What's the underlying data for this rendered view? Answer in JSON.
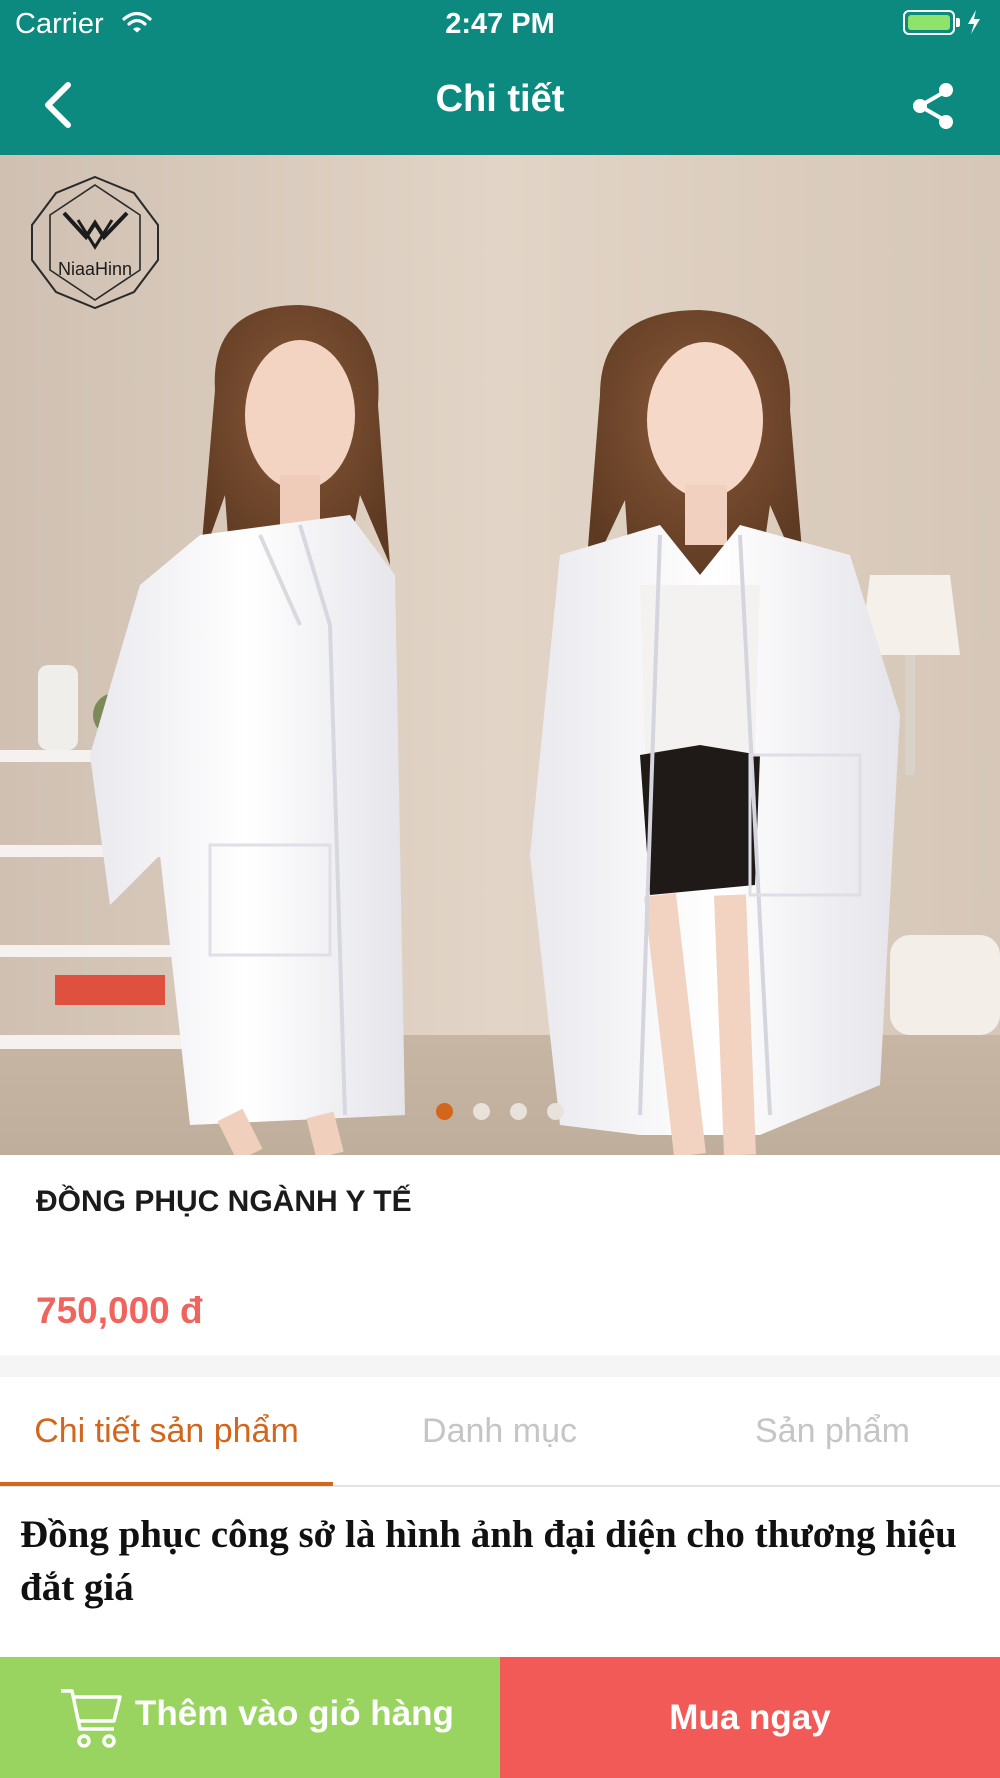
{
  "status_bar": {
    "carrier": "Carrier",
    "time": "2:47 PM",
    "battery_level": 1.0,
    "battery_color": "#8fe36a"
  },
  "nav": {
    "title": "Chi tiết",
    "back_icon": "chevron-left-icon",
    "share_icon": "share-icon"
  },
  "hero": {
    "logo_text": "NiaaHinn",
    "slide_count": 4,
    "active_slide": 1
  },
  "product": {
    "name": "ĐỒNG PHỤC NGÀNH Y TẾ",
    "price": "750,000 đ"
  },
  "tabs": [
    {
      "label": "Chi tiết sản phẩm",
      "active": true
    },
    {
      "label": "Danh mục",
      "active": false
    },
    {
      "label": "Sản phẩm",
      "active": false
    }
  ],
  "description": "Đồng phục công sở là hình ảnh đại diện cho thương hiệu đắt giá",
  "bottom_bar": {
    "add_to_cart_label": "Thêm vào giỏ hàng",
    "buy_now_label": "Mua ngay",
    "cart_icon": "cart-icon"
  },
  "colors": {
    "header": "#0d8a80",
    "accent": "#d2661b",
    "price": "#f0645d",
    "add_to_cart": "#99d461",
    "buy_now": "#f25a58"
  }
}
